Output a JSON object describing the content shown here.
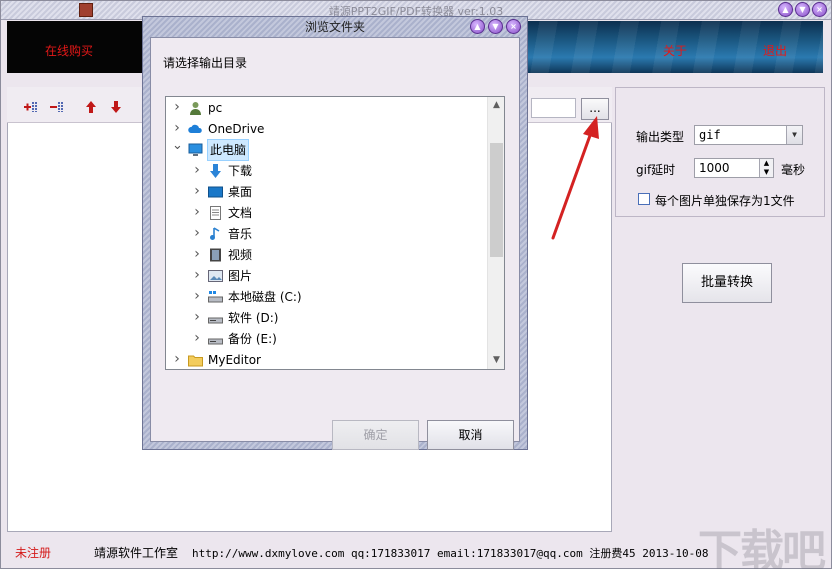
{
  "app": {
    "title": "靖源PPT2GIF/PDF转换器 ver:1.03",
    "window_buttons": [
      "▲",
      "▼",
      "×"
    ]
  },
  "banner": {
    "buy_online": "在线购买",
    "about": "关于",
    "exit": "退出"
  },
  "toolbar": {
    "icons": [
      "add-files-icon",
      "remove-files-icon",
      "move-up-icon",
      "move-down-icon"
    ],
    "browse_button": "..."
  },
  "settings": {
    "output_type_label": "输出类型",
    "output_type_value": "gif",
    "gif_delay_label": "gif延时",
    "gif_delay_value": "1000",
    "gif_delay_unit": "毫秒",
    "separate_file_label": "每个图片单独保存为1文件",
    "batch_convert_button": "批量转换"
  },
  "status": {
    "unregistered": "未注册",
    "studio": "靖源软件工作室",
    "info": "http://www.dxmylove.com qq:171833017 email:171833017@qq.com 注册费45 2013-10-08"
  },
  "watermark": "下载吧",
  "dialog": {
    "title": "浏览文件夹",
    "prompt": "请选择输出目录",
    "tree": [
      {
        "label": "pc",
        "icon": "user-icon",
        "level": 0
      },
      {
        "label": "OneDrive",
        "icon": "cloud-icon",
        "level": 0
      },
      {
        "label": "此电脑",
        "icon": "computer-icon",
        "level": 0,
        "expanded": true,
        "selected": true
      },
      {
        "label": "下载",
        "icon": "download-icon",
        "level": 1
      },
      {
        "label": "桌面",
        "icon": "desktop-icon",
        "level": 1
      },
      {
        "label": "文档",
        "icon": "document-icon",
        "level": 1
      },
      {
        "label": "音乐",
        "icon": "music-icon",
        "level": 1
      },
      {
        "label": "视频",
        "icon": "video-icon",
        "level": 1
      },
      {
        "label": "图片",
        "icon": "picture-icon",
        "level": 1
      },
      {
        "label": "本地磁盘 (C:)",
        "icon": "system-drive-icon",
        "level": 1
      },
      {
        "label": "软件 (D:)",
        "icon": "drive-icon",
        "level": 1
      },
      {
        "label": "备份 (E:)",
        "icon": "drive-icon",
        "level": 1
      },
      {
        "label": "MyEditor",
        "icon": "folder-icon",
        "level": 0
      }
    ],
    "ok_button": "确定",
    "cancel_button": "取消"
  }
}
